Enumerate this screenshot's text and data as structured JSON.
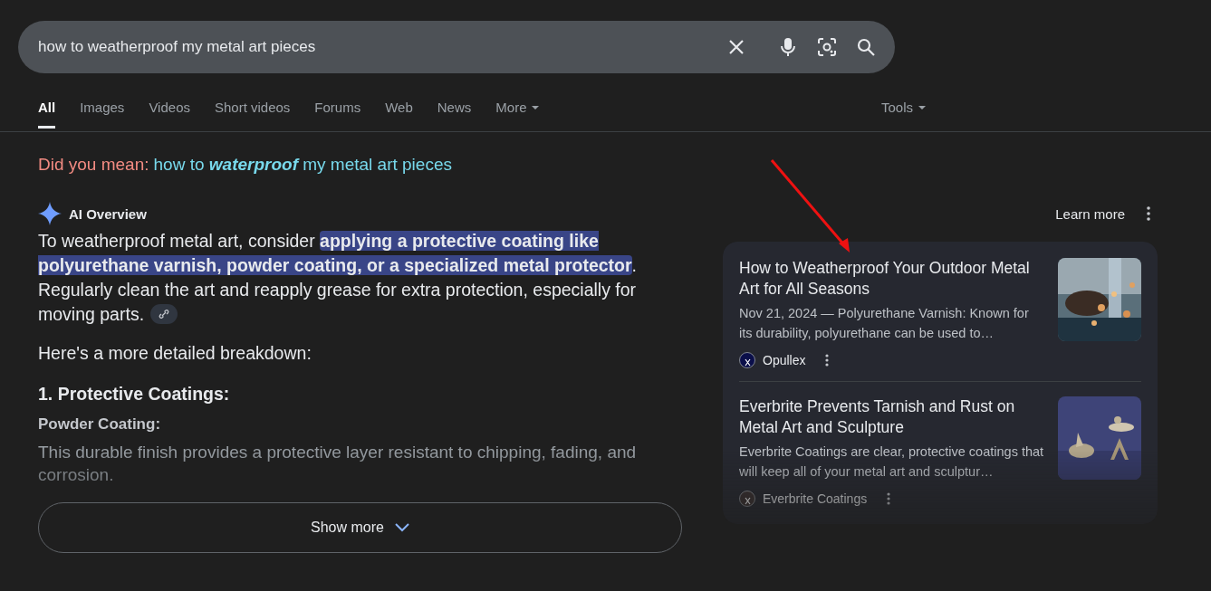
{
  "search": {
    "value": "how to weatherproof my metal art pieces"
  },
  "tabs": [
    {
      "label": "All",
      "selected": true,
      "kind": "tab"
    },
    {
      "label": "Images",
      "selected": false,
      "kind": "tab"
    },
    {
      "label": "Videos",
      "selected": false,
      "kind": "tab"
    },
    {
      "label": "Short videos",
      "selected": false,
      "kind": "tab"
    },
    {
      "label": "Forums",
      "selected": false,
      "kind": "tab"
    },
    {
      "label": "Web",
      "selected": false,
      "kind": "tab"
    },
    {
      "label": "News",
      "selected": false,
      "kind": "tab"
    },
    {
      "label": "More",
      "selected": false,
      "kind": "menu"
    }
  ],
  "tools": "Tools",
  "did_you_mean": {
    "label": "Did you mean:",
    "suggestion": "how to **waterproof** my metal art pieces"
  },
  "ai_overview": {
    "title": "AI Overview",
    "learn_more": "Learn more",
    "intro": [
      {
        "text": "To weatherproof metal art, consider ",
        "highlighted": false
      },
      {
        "text": "applying a protective coating like polyurethane varnish, powder coating, or a specialized metal protector",
        "highlighted": true
      },
      {
        "text": ". Regularly clean the art and reapply grease for extra protection, especially for moving parts.",
        "highlighted": false
      }
    ],
    "breakdown": "Here's a more detailed breakdown:",
    "section_heading": "1. Protective Coatings:",
    "item_heading": "Powder Coating:",
    "item_text": "This durable finish provides a protective layer resistant to chipping, fading, and corrosion.",
    "show_more": "Show more"
  },
  "sources": [
    {
      "title": "How to Weatherproof Your Outdoor Metal Art for All Seasons",
      "snippet": "Nov 21, 2024 — Polyurethane Varnish: Known for its durability, polyurethane can be used to…",
      "site": "Opullex",
      "kind": "picture"
    },
    {
      "title": "Everbrite Prevents Tarnish and Rust on Metal Art and Sculpture",
      "snippet": "Everbrite Coatings are clear, protective coatings that will keep all of your metal art and sculptur…",
      "site": "Everbrite Coatings",
      "kind": "picture"
    }
  ]
}
